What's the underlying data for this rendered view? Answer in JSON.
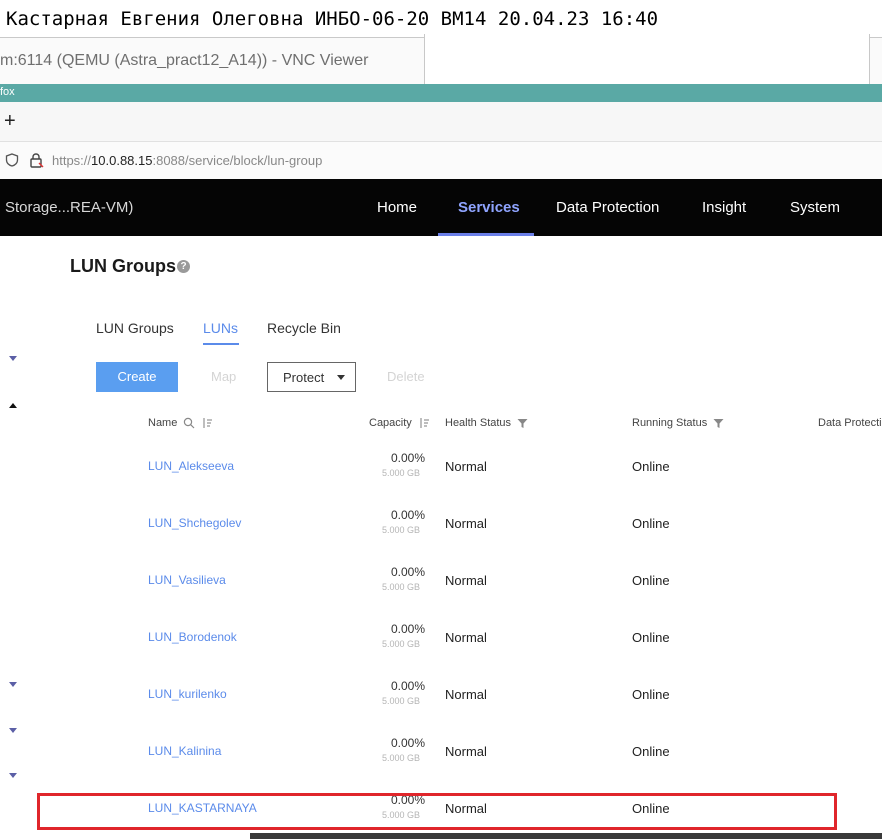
{
  "caption": "Кастарная Евгения Олеговна ИНБО-06-20 ВМ14 20.04.23 16:40",
  "vnc_title": "m:6114 (QEMU (Astra_pract12_A14)) - VNC Viewer",
  "browser": {
    "strip_label": "fox",
    "new_tab": "+",
    "url_prefix": "https://",
    "url_host": "10.0.88.15",
    "url_path": ":8088/service/block/lun-group"
  },
  "nav": {
    "brand": "Storage...REA-VM)",
    "items": [
      "Home",
      "Services",
      "Data Protection",
      "Insight",
      "System"
    ],
    "active": "Services"
  },
  "page": {
    "title": "LUN Groups",
    "help": "?"
  },
  "subtabs": [
    "LUN Groups",
    "LUNs",
    "Recycle Bin"
  ],
  "toolbar": {
    "create": "Create",
    "map": "Map",
    "protect": "Protect",
    "delete": "Delete"
  },
  "table": {
    "headers": [
      "Name",
      "Capacity",
      "Health Status",
      "Running Status",
      "Data Protecti"
    ],
    "rows": [
      {
        "name": "LUN_Alekseeva",
        "pct": "0.00%",
        "size": "5.000 GB",
        "health": "Normal",
        "running": "Online"
      },
      {
        "name": "LUN_Shchegolev",
        "pct": "0.00%",
        "size": "5.000 GB",
        "health": "Normal",
        "running": "Online"
      },
      {
        "name": "LUN_Vasilieva",
        "pct": "0.00%",
        "size": "5.000 GB",
        "health": "Normal",
        "running": "Online"
      },
      {
        "name": "LUN_Borodenok",
        "pct": "0.00%",
        "size": "5.000 GB",
        "health": "Normal",
        "running": "Online"
      },
      {
        "name": "LUN_kurilenko",
        "pct": "0.00%",
        "size": "5.000 GB",
        "health": "Normal",
        "running": "Online"
      },
      {
        "name": "LUN_Kalinina",
        "pct": "0.00%",
        "size": "5.000 GB",
        "health": "Normal",
        "running": "Online"
      },
      {
        "name": "LUN_KASTARNAYA",
        "pct": "0.00%",
        "size": "5.000 GB",
        "health": "Normal",
        "running": "Online"
      }
    ]
  },
  "colors": {
    "accent": "#5b8bea",
    "nav_bg": "#050505",
    "nav_active": "#8fa4ff",
    "create_btn": "#5a9ef0",
    "highlight": "#e0262b",
    "teal_strip": "#5aa9a5"
  }
}
